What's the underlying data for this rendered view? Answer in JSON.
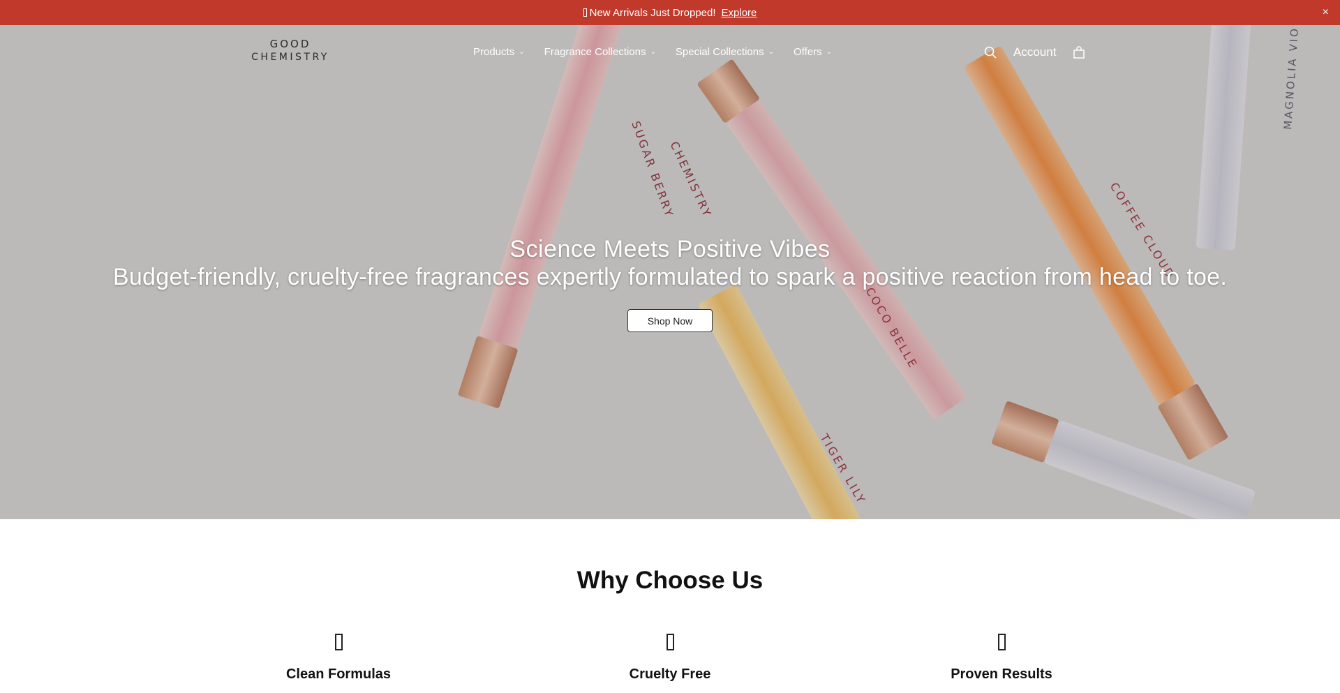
{
  "announcement": {
    "text": "New Arrivals Just Dropped!",
    "link_label": "Explore",
    "close_label": "×",
    "bg_color": "#c0392b"
  },
  "brand": {
    "logo_line1": "GOOD",
    "logo_line2": "CHEMISTRY"
  },
  "nav": {
    "items": [
      {
        "label": "Products"
      },
      {
        "label": "Fragrance Collections"
      },
      {
        "label": "Special Collections"
      },
      {
        "label": "Offers"
      }
    ]
  },
  "header_actions": {
    "search_icon": "search-icon",
    "account_label": "Account",
    "cart_icon": "shopping-bag-icon"
  },
  "hero": {
    "title": "Science Meets Positive Vibes",
    "subtitle": "Budget-friendly, cruelty-free fragrances expertly formulated to spark a positive reaction from head to toe.",
    "cta_label": "Shop Now",
    "bottle_labels": [
      "SUGAR BERRY",
      "CHEMISTRY",
      "COCO BELLE",
      "COFFEE CLOUD",
      "TIGER LILY",
      "MAGNOLIA VIO"
    ]
  },
  "why": {
    "title": "Why Choose Us",
    "features": [
      {
        "label": "Clean Formulas"
      },
      {
        "label": "Cruelty Free"
      },
      {
        "label": "Proven Results"
      }
    ]
  }
}
